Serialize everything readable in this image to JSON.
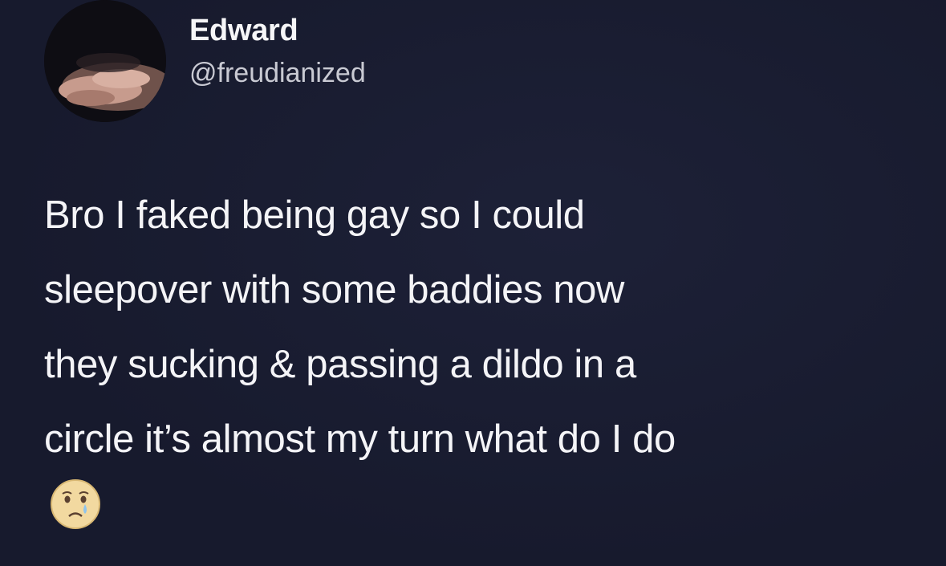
{
  "tweet": {
    "author": {
      "display_name": "Edward",
      "handle": "@freudianized"
    },
    "body_lines": [
      "Bro I faked being gay so I could",
      "sleepover with some baddies now",
      "they sucking & passing a dildo in a",
      "circle it’s almost my turn what do I do"
    ],
    "trailing_emoji": "crying-face-emoji"
  },
  "colors": {
    "background": "#171a2d",
    "text": "#f4f4f7",
    "handle_text": "#c9cad3"
  }
}
